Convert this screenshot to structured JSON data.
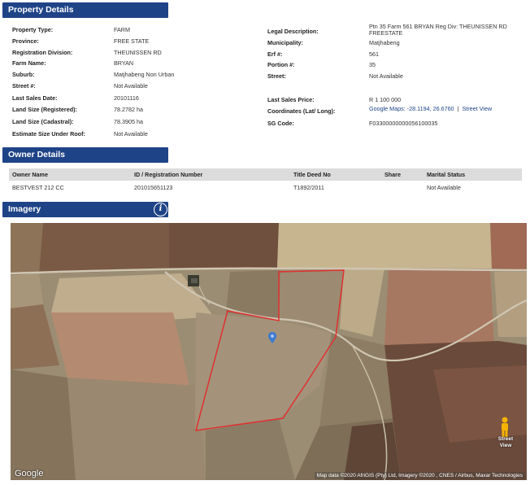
{
  "property_section": {
    "title": "Property Details",
    "left": [
      {
        "label": "Property Type:",
        "value": "FARM"
      },
      {
        "label": "Province:",
        "value": "FREE STATE"
      },
      {
        "label": "Registration Division:",
        "value": "THEUNISSEN RD"
      },
      {
        "label": "Farm Name:",
        "value": "BRYAN"
      },
      {
        "label": "Suburb:",
        "value": "Matjhabeng Non Urban"
      },
      {
        "label": "Street #:",
        "value": "Not Available"
      },
      {
        "label": "Last Sales Date:",
        "value": "20101116"
      },
      {
        "label": "Land Size (Registered):",
        "value": "78.2782 ha"
      },
      {
        "label": "Land Size (Cadastral):",
        "value": "78.3905 ha"
      },
      {
        "label": "Estimate Size Under Roof:",
        "value": "Not Available"
      }
    ],
    "right": [
      {
        "label": "Legal Description:",
        "value": "Ptn 35 Farm 561 BRYAN Reg Div: THEUNISSEN RD FREESTATE"
      },
      {
        "label": "Municipality:",
        "value": "Matjhabeng"
      },
      {
        "label": "Erf #:",
        "value": "561"
      },
      {
        "label": "Portion #:",
        "value": "35"
      },
      {
        "label": "Street:",
        "value": "Not Available"
      },
      {
        "label": "Last Sales Price:",
        "value": "R 1 100 000"
      },
      {
        "label": "Coordinates (Lat/ Long):",
        "value": "Google Maps: -28.1194, 26.6760",
        "separator": "|",
        "link": "Street View"
      },
      {
        "label": "SG Code:",
        "value": "F03300000000056100035"
      }
    ]
  },
  "owner_section": {
    "title": "Owner Details",
    "columns": [
      "Owner Name",
      "ID / Registration Number",
      "Title Deed No",
      "Share",
      "Marital Status"
    ],
    "rows": [
      [
        "BESTVEST 212 CC",
        "201015651123",
        "T1892/2011",
        "",
        "Not Available"
      ]
    ]
  },
  "imagery_section": {
    "title": "Imagery",
    "info_icon": "info-icon",
    "map": {
      "logo": "Google",
      "credits": "Map data ©2020 AfriGIS (Pty) Ltd, Imagery ©2020 , CNES / Airbus, Maxar Technologies",
      "street_view_label": "Street View",
      "colors": {
        "boundary": "#e03030",
        "pin": "#3c7ad0"
      }
    }
  }
}
